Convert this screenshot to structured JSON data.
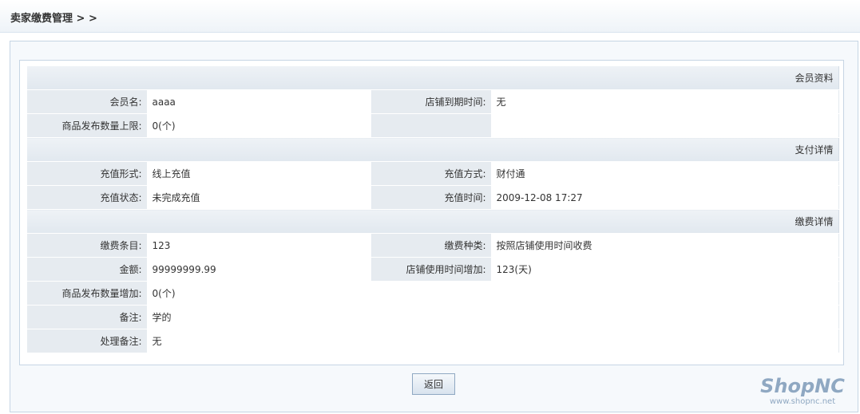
{
  "header": {
    "breadcrumb": "卖家缴费管理 > >"
  },
  "sections": {
    "member": {
      "title": "会员资料",
      "member_name_label": "会员名:",
      "member_name_value": "aaaa",
      "shop_expire_label": "店铺到期时间:",
      "shop_expire_value": "无",
      "goods_limit_label": "商品发布数量上限:",
      "goods_limit_value": "0(个)"
    },
    "payment": {
      "title": "支付详情",
      "recharge_form_label": "充值形式:",
      "recharge_form_value": "线上充值",
      "recharge_method_label": "充值方式:",
      "recharge_method_value": "财付通",
      "recharge_status_label": "充值状态:",
      "recharge_status_value": "未完成充值",
      "recharge_time_label": "充值时间:",
      "recharge_time_value": "2009-12-08 17:27"
    },
    "fee": {
      "title": "缴费详情",
      "fee_item_label": "缴费条目:",
      "fee_item_value": "123",
      "fee_type_label": "缴费种类:",
      "fee_type_value": "按照店铺使用时间收费",
      "amount_label": "金额:",
      "amount_value": "99999999.99",
      "shop_time_label": "店铺使用时间增加:",
      "shop_time_value": "123(天)",
      "goods_increase_label": "商品发布数量增加:",
      "goods_increase_value": "0(个)",
      "remark_label": "备注:",
      "remark_value": "学的",
      "handle_remark_label": "处理备注:",
      "handle_remark_value": "无"
    }
  },
  "actions": {
    "back_label": "返回"
  },
  "logo": {
    "text": "ShopNC",
    "url": "www.shopnc.net"
  },
  "colors": {
    "label_bg": "#e6ebf0",
    "section_bg": "#e1e8ef",
    "border": "#c6d5e4",
    "logo": "#8fa8c2"
  }
}
